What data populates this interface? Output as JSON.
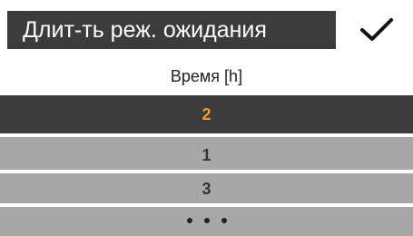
{
  "header": {
    "title": "Длит-ть реж. ожидания",
    "confirm_icon": "checkmark-icon"
  },
  "subtitle": "Время [h]",
  "list": {
    "selected": "2",
    "options": [
      "1",
      "3"
    ],
    "more_icon": "ellipsis-icon"
  },
  "colors": {
    "dark": "#3c3c3c",
    "accent": "#f29a2e",
    "list_bg": "#a7a7a7",
    "text": "#333333"
  }
}
